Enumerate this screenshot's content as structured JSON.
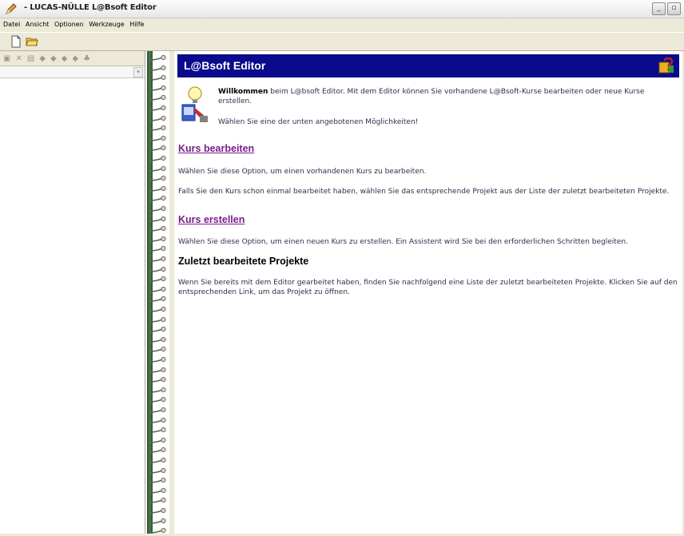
{
  "window": {
    "title": "- LUCAS-NÜLLE L@Bsoft Editor",
    "buttons": {
      "minimize": "_",
      "restore": "▫"
    }
  },
  "menu": {
    "items": [
      "Datei",
      "Ansicht",
      "Optionen",
      "Werkzeuge",
      "Hilfe"
    ]
  },
  "header": {
    "title": "L@Bsoft Editor"
  },
  "intro": {
    "welcome_bold": "Willkommen",
    "welcome_rest": " beim L@bsoft Editor. Mit dem Editor können Sie vorhandene L@Bsoft-Kurse bearbeiten oder neue Kurse erstellen.",
    "choose": "Wählen Sie eine der unten angebotenen Möglichkeiten!"
  },
  "sections": {
    "edit": {
      "title": "Kurs bearbeiten",
      "text1": "Wählen Sie diese Option, um einen vorhandenen Kurs zu bearbeiten.",
      "text2": "Falls Sie den Kurs schon einmal bearbeitet haben, wählen Sie das entsprechende Projekt aus der Liste der zuletzt bearbeiteten Projekte."
    },
    "create": {
      "title": "Kurs erstellen",
      "text": "Wählen Sie diese Option, um einen neuen Kurs zu erstellen. Ein Assistent wird Sie bei den erforderlichen Schritten begleiten."
    },
    "recent": {
      "title": "Zuletzt bearbeitete Projekte",
      "text": "Wenn Sie bereits mit dem Editor gearbeitet haben, finden Sie nachfolgend eine Liste der zuletzt bearbeiteten Projekte. Klicken Sie auf den entsprechenden Link, um das Projekt zu öffnen."
    }
  },
  "colors": {
    "header_bg": "#0a0a8c",
    "link": "#7a1d8c",
    "spine": "#3d6b3b"
  }
}
